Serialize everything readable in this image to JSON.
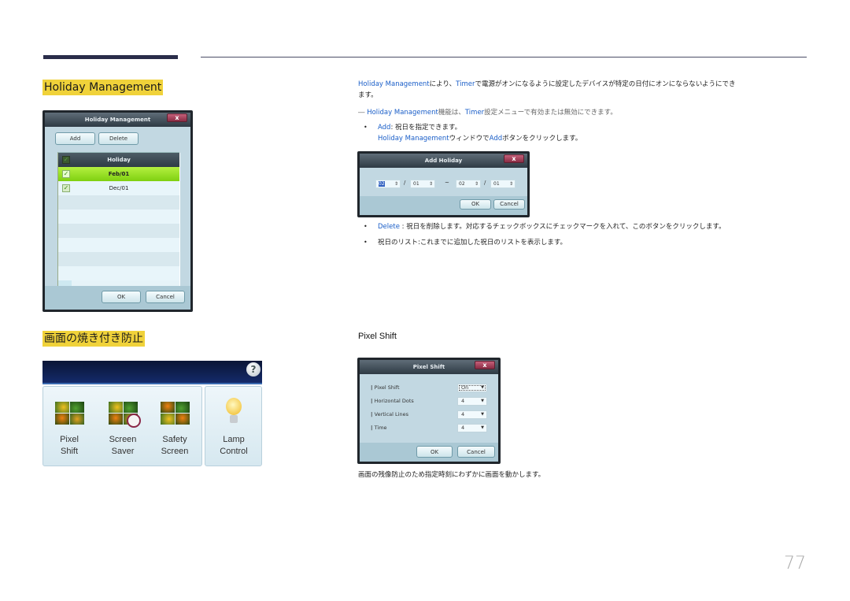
{
  "page_number": "77",
  "sections": {
    "holiday": {
      "title": "Holiday Management",
      "description": {
        "p1_a": "Holiday Management",
        "p1_b": "により、",
        "p1_c": "Timer",
        "p1_d": "で電源がオンになるように設定したデバイスが特定の日付にオンにならないようにでき",
        "p1_e": "ます。",
        "note_mark": "―",
        "note_a": "Holiday Management",
        "note_b": "機能は、",
        "note_c": "Timer",
        "note_d": "設定メニューで有効または無効にできます。",
        "bullet_add_a": "Add",
        "bullet_add_b": ": 祝日を指定できます。",
        "bullet_add_sub_a": "Holiday Management",
        "bullet_add_sub_b": "ウィンドウで",
        "bullet_add_sub_c": "Add",
        "bullet_add_sub_d": "ボタンをクリックします。",
        "bullet_delete_a": "Delete",
        "bullet_delete_b": " : 祝日を削除します。対応するチェックボックスにチェックマークを入れて、このボタンをクリックします。",
        "bullet_list": "祝日のリスト:これまでに追加した祝日のリストを表示します。",
        "bullet_char": "•"
      },
      "dialog": {
        "title": "Holiday Management",
        "close": "x",
        "add_label": "Add",
        "delete_label": "Delete",
        "list_header": "Holiday",
        "rows": [
          {
            "date": "Feb/01",
            "checked": true,
            "selected": true
          },
          {
            "date": "Dec/01",
            "checked": true,
            "selected": false
          }
        ],
        "ok_label": "OK",
        "cancel_label": "Cancel"
      },
      "add_dialog": {
        "title": "Add Holiday",
        "close": "x",
        "from_month": "02",
        "from_day": "01",
        "range_sep": "~",
        "to_month": "02",
        "to_day": "01",
        "slash": "/",
        "spin_arrow": "⇕",
        "ok_label": "OK",
        "cancel_label": "Cancel"
      }
    },
    "burn_in": {
      "title": "画面の焼き付き防止",
      "help": "?",
      "items": [
        {
          "line1": "Pixel",
          "line2": "Shift"
        },
        {
          "line1": "Screen",
          "line2": "Saver"
        },
        {
          "line1": "Safety",
          "line2": "Screen"
        },
        {
          "line1": "Lamp",
          "line2": "Control"
        }
      ],
      "pixel_shift": {
        "heading": "Pixel Shift",
        "dialog_title": "Pixel Shift",
        "close": "x",
        "fields": [
          {
            "label": "Pixel Shift",
            "value": "On"
          },
          {
            "label": "Horizontal Dots",
            "value": "4"
          },
          {
            "label": "Vertical Lines",
            "value": "4"
          },
          {
            "label": "Time",
            "value": "4"
          }
        ],
        "ok_label": "OK",
        "cancel_label": "Cancel",
        "caption": "画面の残像防止のため指定時刻にわずかに画面を動かします。"
      }
    }
  }
}
